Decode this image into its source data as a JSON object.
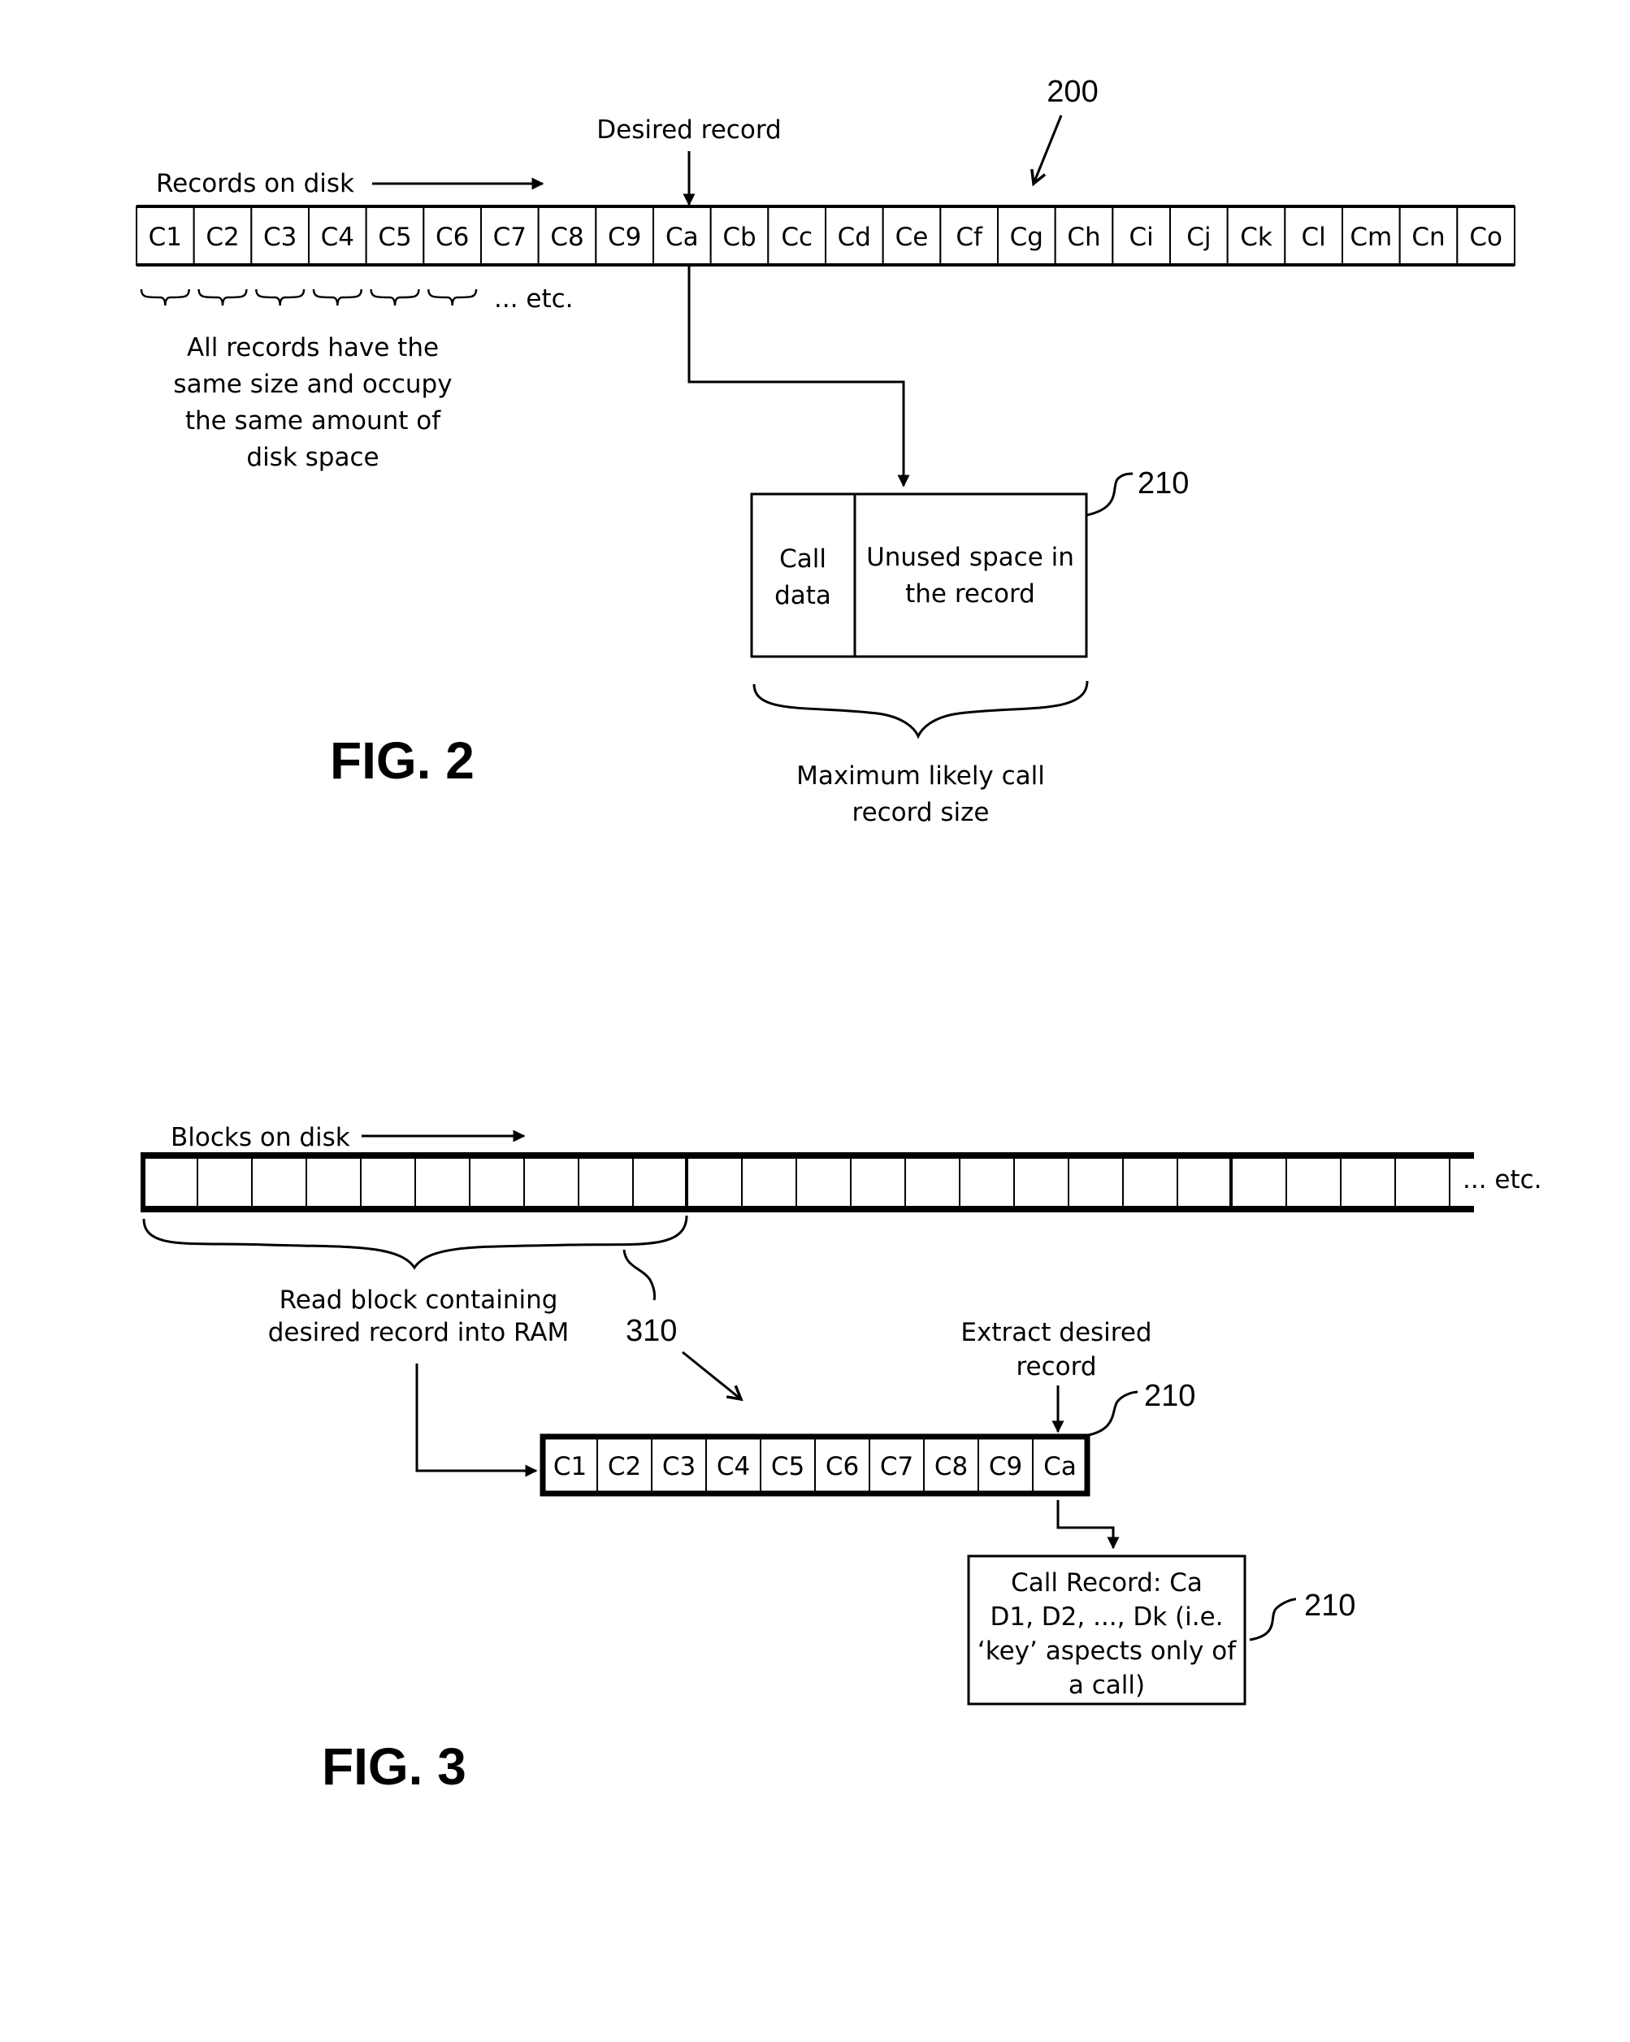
{
  "figures": [
    {
      "id": "fig2",
      "caption": "FIG. 2",
      "reference_numeral": "200",
      "strip_label": "Records on disk",
      "desired_label": "Desired record",
      "records": [
        "C1",
        "C2",
        "C3",
        "C4",
        "C5",
        "C6",
        "C7",
        "C8",
        "C9",
        "Ca",
        "Cb",
        "Cc",
        "Cd",
        "Ce",
        "Cf",
        "Cg",
        "Ch",
        "Ci",
        "Cj",
        "Ck",
        "Cl",
        "Cm",
        "Cn",
        "Co"
      ],
      "desired_record": "Ca",
      "braces_suffix": "... etc.",
      "size_note": [
        "All records have the",
        "same size and occupy",
        "the same amount of",
        "disk space"
      ],
      "record_box": {
        "numeral": "210",
        "call_data": [
          "Call",
          "data"
        ],
        "unused": [
          "Unused space in",
          "the record"
        ],
        "size_caption": [
          "Maximum likely call",
          "record size"
        ]
      }
    },
    {
      "id": "fig3",
      "caption": "FIG. 3",
      "strip_label": "Blocks on disk",
      "strip_suffix": "... etc.",
      "blocks": [
        {
          "cells": 10
        },
        {
          "cells": 10
        },
        {
          "cells": 4,
          "open_end": true
        }
      ],
      "read_note": [
        "Read block containing",
        "desired record into RAM"
      ],
      "block_numeral": "310",
      "ram_block": {
        "numeral": "210",
        "records": [
          "C1",
          "C2",
          "C3",
          "C4",
          "C5",
          "C6",
          "C7",
          "C8",
          "C9",
          "Ca"
        ]
      },
      "extract_label": [
        "Extract desired",
        "record"
      ],
      "call_record_box": {
        "numeral": "210",
        "lines": [
          "Call Record: Ca",
          "D1, D2, ..., Dk (i.e.",
          "‘key’ aspects only of",
          "a call)"
        ]
      }
    }
  ]
}
